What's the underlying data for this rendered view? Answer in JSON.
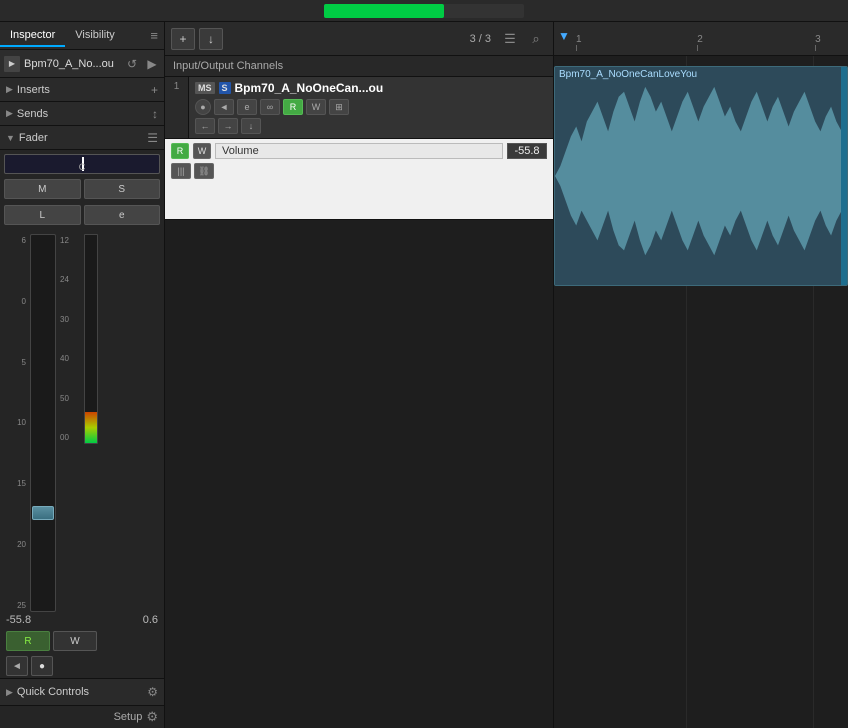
{
  "topbar": {
    "progress": 60
  },
  "inspector": {
    "tab_inspector": "Inspector",
    "tab_visibility": "Visibility",
    "track_name": "Bpm70_A_No...ou",
    "inserts_label": "Inserts",
    "sends_label": "Sends",
    "fader_label": "Fader",
    "btn_m": "M",
    "btn_s": "S",
    "btn_l": "L",
    "btn_e": "e",
    "fader_value": "-55.8",
    "fader_pan": "0.6",
    "btn_r": "R",
    "btn_w": "W",
    "scale_left": [
      "6",
      "0",
      "5",
      "10",
      "15",
      "20",
      "25"
    ],
    "scale_right": [
      "12",
      "24",
      "30",
      "40",
      "50",
      "00"
    ]
  },
  "quick_controls": {
    "label": "Quick Controls",
    "setup_label": "Setup"
  },
  "center": {
    "toolbar": {
      "add_btn": "+",
      "import_btn": "↓",
      "track_count": "3 / 3",
      "list_icon": "☰",
      "search_icon": "⌕"
    },
    "io_header": "Input/Output Channels",
    "channel": {
      "num": "1",
      "badge_ms": "MS",
      "badge_s": "S",
      "name": "Bpm70_A_NoOneCan...ou",
      "btn_power": "●",
      "btn_left": "◄",
      "btn_e": "e",
      "btn_chain": "∞",
      "btn_r_green": "R",
      "btn_w": "W",
      "btn_grid": "⊞",
      "btn_arrow_left": "←",
      "btn_arrow_right": "→",
      "btn_down": "↓"
    },
    "volume": {
      "btn_r": "R",
      "btn_w": "W",
      "name": "Volume",
      "value": "-55.8",
      "btn_bars": "|||",
      "btn_link": "⛓"
    }
  },
  "timeline": {
    "filter_icon": "▼",
    "marks": [
      {
        "label": "1",
        "pos_pct": 0
      },
      {
        "label": "2",
        "pos_pct": 45
      },
      {
        "label": "3",
        "pos_pct": 88
      }
    ],
    "clip_label": "Bpm70_A_NoOneCanLoveYou"
  }
}
